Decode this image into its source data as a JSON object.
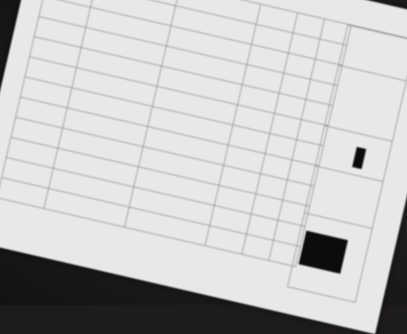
{
  "document": {
    "table_rows": [
      [
        "",
        "",
        "",
        "",
        "",
        ""
      ],
      [
        "",
        "",
        "",
        "",
        "",
        ""
      ],
      [
        "",
        "",
        "",
        "",
        "",
        ""
      ],
      [
        "",
        "",
        "",
        "",
        "",
        ""
      ],
      [
        "",
        "",
        "",
        "",
        "",
        ""
      ],
      [
        "",
        "",
        "",
        "",
        "",
        ""
      ],
      [
        "",
        "",
        "",
        "",
        "",
        ""
      ],
      [
        "",
        "",
        "",
        "",
        "",
        ""
      ],
      [
        "",
        "",
        "",
        "",
        "",
        ""
      ],
      [
        "",
        "",
        "",
        "",
        "",
        ""
      ],
      [
        "",
        "",
        "",
        "",
        "",
        ""
      ],
      [
        "",
        "",
        "",
        "",
        "",
        ""
      ]
    ],
    "side_cells": [
      "",
      "",
      "",
      "",
      ""
    ],
    "footer": ""
  },
  "colors": {
    "paper": "#e9e8e6",
    "ink": "#2a2a2a",
    "background": "#1e1b1b",
    "redaction": "#0c0c0c"
  }
}
